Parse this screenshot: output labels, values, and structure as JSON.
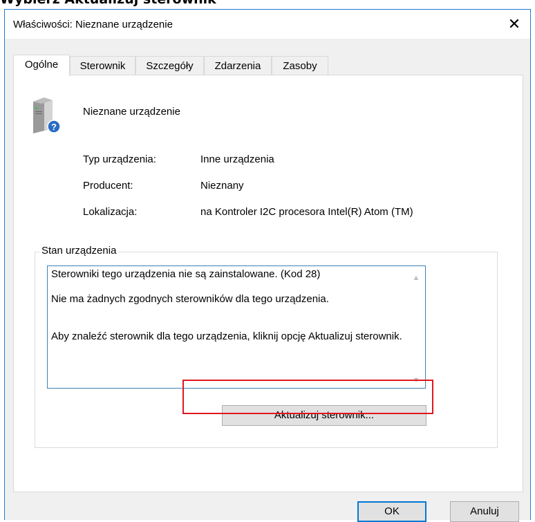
{
  "page_heading": "Wybierz Aktualizuj sterownik",
  "dialog": {
    "title": "Właściwości: Nieznane urządzenie",
    "close_symbol": "✕"
  },
  "tabs": [
    {
      "label": "Ogólne",
      "active": true
    },
    {
      "label": "Sterownik",
      "active": false
    },
    {
      "label": "Szczegóły",
      "active": false
    },
    {
      "label": "Zdarzenia",
      "active": false
    },
    {
      "label": "Zasoby",
      "active": false
    }
  ],
  "device": {
    "icon": "unknown-device-icon",
    "name": "Nieznane urządzenie"
  },
  "properties": [
    {
      "label": "Typ urządzenia:",
      "value": "Inne urządzenia"
    },
    {
      "label": "Producent:",
      "value": "Nieznany"
    },
    {
      "label": "Lokalizacja:",
      "value": "na Kontroler I2C procesora Intel(R) Atom (TM)"
    }
  ],
  "status": {
    "caption": "Stan urządzenia",
    "lines": [
      "Sterowniki tego urządzenia nie są zainstalowane. (Kod 28)",
      "Nie ma żadnych zgodnych sterowników dla tego urządzenia.",
      "Aby znaleźć sterownik dla tego urządzenia, kliknij opcję Aktualizuj sterownik."
    ],
    "update_button": "Aktualizuj sterownik..."
  },
  "footer": {
    "ok": "OK",
    "cancel": "Anuluj"
  },
  "colors": {
    "highlight": "#e0161e",
    "dialog_border": "#1e78d7",
    "default_button_border": "#0078d7"
  }
}
